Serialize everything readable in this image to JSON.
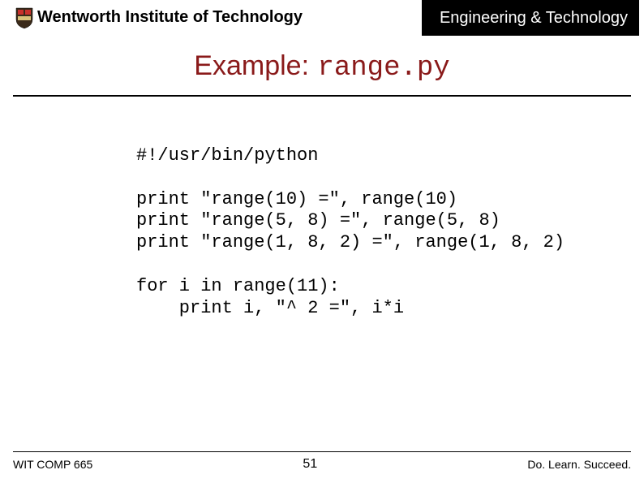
{
  "header": {
    "institution": "Wentworth Institute of Technology",
    "department": "Engineering & Technology"
  },
  "title": {
    "label": "Example:",
    "code": "range.py"
  },
  "code": {
    "line1": "#!/usr/bin/python",
    "line2": "",
    "line3": "print \"range(10) =\", range(10)",
    "line4": "print \"range(5, 8) =\", range(5, 8)",
    "line5": "print \"range(1, 8, 2) =\", range(1, 8, 2)",
    "line6": "",
    "line7": "for i in range(11):",
    "line8": "    print i, \"^ 2 =\", i*i"
  },
  "footer": {
    "course": "WIT COMP 665",
    "page": "51",
    "tagline": "Do. Learn. Succeed."
  }
}
